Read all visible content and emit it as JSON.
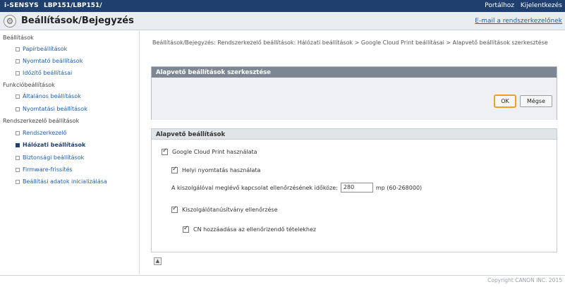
{
  "topbar": {
    "brand": "i-SENSYS",
    "model": "LBP151/LBP151/",
    "links": [
      "Portálhoz",
      "Kijelentkezés"
    ]
  },
  "header": {
    "title": "Beállítások/Bejegyzés",
    "email_link": "E-mail a rendszerkezelőnek"
  },
  "sidebar": {
    "sections": [
      {
        "label": "Beállítások",
        "items": [
          "Papírbeállítások",
          "Nyomtató beállítások",
          "Időzítő beállításai"
        ]
      },
      {
        "label": "Funkcióbeállítások",
        "items": [
          "Általános beállítások",
          "Nyomtatási beállítások"
        ]
      },
      {
        "label": "Rendszerkezelő beállítások",
        "items": [
          "Rendszerkezelő",
          "Hálózati beállítások",
          "Biztonsági beállítások",
          "Firmware-frissítés",
          "Beállítási adatok inicializálása"
        ]
      }
    ],
    "active": "Hálózati beállítások"
  },
  "main": {
    "breadcrumb": "Beállítások/Bejegyzés: Rendszerkezelő beállítások: Hálózati beállítások > Google Cloud Print beállításai > Alapvető beállítások szerkesztése",
    "edit_panel_title": "Alapvető beállítások szerkesztése",
    "ok_label": "OK",
    "cancel_label": "Mégse",
    "basic_panel_title": "Alapvető beállítások",
    "options": {
      "use_gcp": "Google Cloud Print használata",
      "local_print": "Helyi nyomtatás használata",
      "timeout_label": "A kiszolgálóval meglévő kapcsolat ellenőrzésének időköze:",
      "timeout_value": "280",
      "timeout_unit": "mp (60-268000)",
      "verify_cert": "Kiszolgálótanúsítvány ellenőrzése",
      "add_cn": "CN hozzáadása az ellenőrizendő tételekhez"
    }
  },
  "footer": {
    "copyright": "Copyright CANON INC. 2015"
  }
}
